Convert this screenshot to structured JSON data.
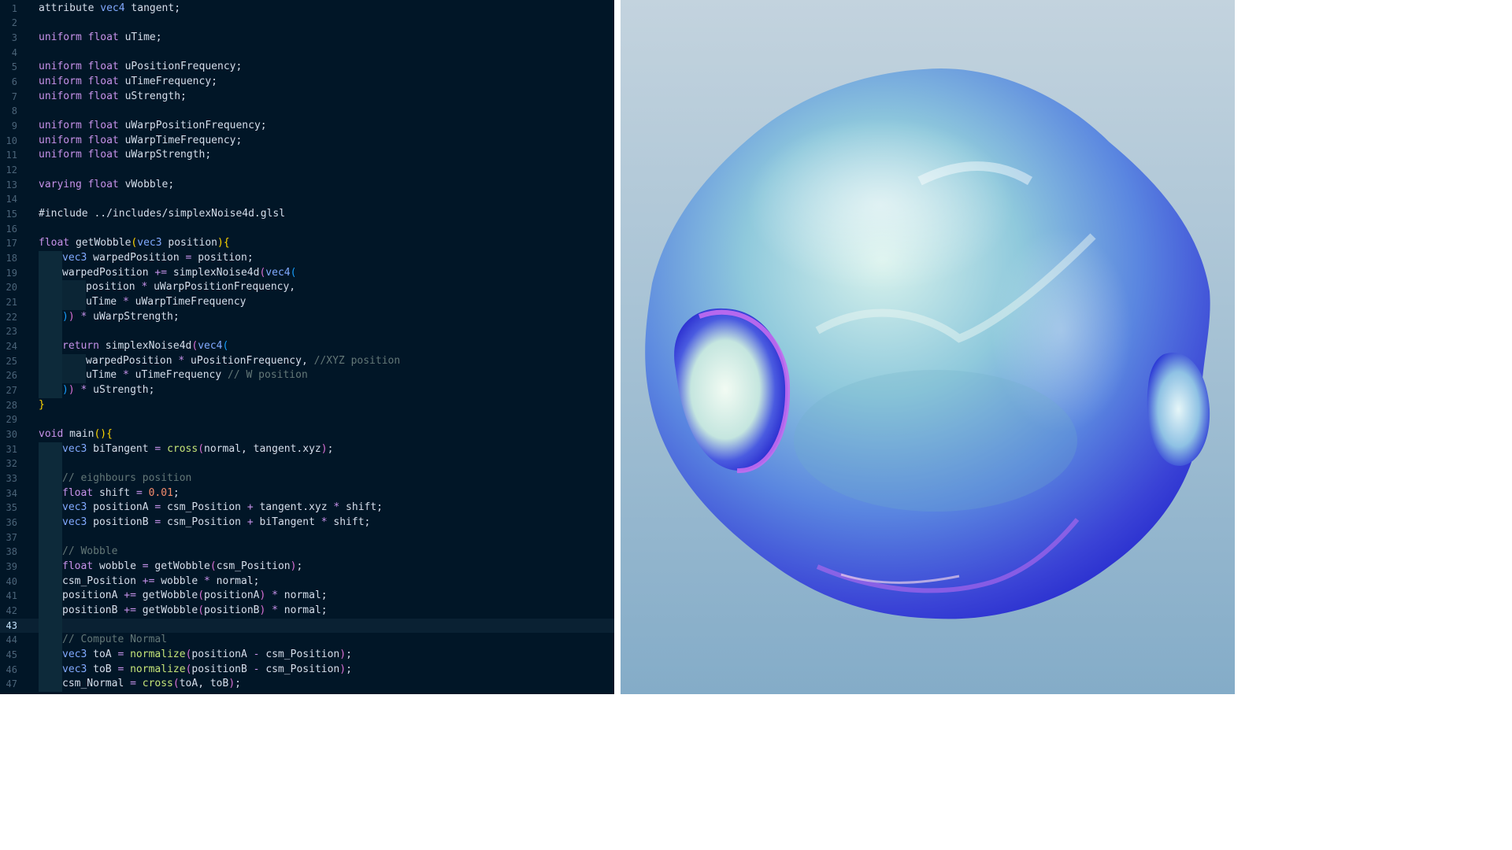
{
  "editor": {
    "current_line": 43,
    "lines": [
      {
        "n": "1",
        "tokens": [
          [
            "id",
            "attribute "
          ],
          [
            "ty",
            "vec4"
          ],
          [
            "id",
            " tangent;"
          ]
        ]
      },
      {
        "n": "2",
        "tokens": []
      },
      {
        "n": "3",
        "tokens": [
          [
            "kw",
            "uniform"
          ],
          [
            "id",
            " "
          ],
          [
            "kw",
            "float"
          ],
          [
            "id",
            " uTime;"
          ]
        ]
      },
      {
        "n": "4",
        "tokens": []
      },
      {
        "n": "5",
        "tokens": [
          [
            "kw",
            "uniform"
          ],
          [
            "id",
            " "
          ],
          [
            "kw",
            "float"
          ],
          [
            "id",
            " uPositionFrequency;"
          ]
        ]
      },
      {
        "n": "6",
        "tokens": [
          [
            "kw",
            "uniform"
          ],
          [
            "id",
            " "
          ],
          [
            "kw",
            "float"
          ],
          [
            "id",
            " uTimeFrequency;"
          ]
        ]
      },
      {
        "n": "7",
        "tokens": [
          [
            "kw",
            "uniform"
          ],
          [
            "id",
            " "
          ],
          [
            "kw",
            "float"
          ],
          [
            "id",
            " uStrength;"
          ]
        ]
      },
      {
        "n": "8",
        "tokens": []
      },
      {
        "n": "9",
        "tokens": [
          [
            "kw",
            "uniform"
          ],
          [
            "id",
            " "
          ],
          [
            "kw",
            "float"
          ],
          [
            "id",
            " uWarpPositionFrequency;"
          ]
        ]
      },
      {
        "n": "10",
        "tokens": [
          [
            "kw",
            "uniform"
          ],
          [
            "id",
            " "
          ],
          [
            "kw",
            "float"
          ],
          [
            "id",
            " uWarpTimeFrequency;"
          ]
        ]
      },
      {
        "n": "11",
        "tokens": [
          [
            "kw",
            "uniform"
          ],
          [
            "id",
            " "
          ],
          [
            "kw",
            "float"
          ],
          [
            "id",
            " uWarpStrength;"
          ]
        ]
      },
      {
        "n": "12",
        "tokens": []
      },
      {
        "n": "13",
        "tokens": [
          [
            "kw",
            "varying"
          ],
          [
            "id",
            " "
          ],
          [
            "kw",
            "float"
          ],
          [
            "id",
            " vWobble;"
          ]
        ]
      },
      {
        "n": "14",
        "tokens": []
      },
      {
        "n": "15",
        "tokens": [
          [
            "id",
            "#include ../includes/simplexNoise4d.glsl"
          ]
        ]
      },
      {
        "n": "16",
        "tokens": []
      },
      {
        "n": "17",
        "tokens": [
          [
            "kw",
            "float"
          ],
          [
            "id",
            " getWobble"
          ],
          [
            "br1",
            "("
          ],
          [
            "ty",
            "vec3"
          ],
          [
            "id",
            " position"
          ],
          [
            "br1",
            ")"
          ],
          [
            "br1",
            "{"
          ]
        ]
      },
      {
        "n": "18",
        "indent": 1,
        "tokens": [
          [
            "ty",
            "vec3"
          ],
          [
            "id",
            " warpedPosition "
          ],
          [
            "op",
            "="
          ],
          [
            "id",
            " position;"
          ]
        ]
      },
      {
        "n": "19",
        "indent": 1,
        "tokens": [
          [
            "id",
            "warpedPosition "
          ],
          [
            "op",
            "+="
          ],
          [
            "id",
            " simplexNoise4d"
          ],
          [
            "br2",
            "("
          ],
          [
            "ty",
            "vec4"
          ],
          [
            "br3",
            "("
          ]
        ]
      },
      {
        "n": "20",
        "indent": 2,
        "tokens": [
          [
            "id",
            "position "
          ],
          [
            "op",
            "*"
          ],
          [
            "id",
            " uWarpPositionFrequency,"
          ]
        ]
      },
      {
        "n": "21",
        "indent": 2,
        "tokens": [
          [
            "id",
            "uTime "
          ],
          [
            "op",
            "*"
          ],
          [
            "id",
            " uWarpTimeFrequency"
          ]
        ]
      },
      {
        "n": "22",
        "indent": 1,
        "tokens": [
          [
            "br3",
            ")"
          ],
          [
            "br2",
            ")"
          ],
          [
            "id",
            " "
          ],
          [
            "op",
            "*"
          ],
          [
            "id",
            " uWarpStrength;"
          ]
        ]
      },
      {
        "n": "23",
        "indent": 1,
        "tokens": []
      },
      {
        "n": "24",
        "indent": 1,
        "tokens": [
          [
            "kw",
            "return"
          ],
          [
            "id",
            " simplexNoise4d"
          ],
          [
            "br2",
            "("
          ],
          [
            "ty",
            "vec4"
          ],
          [
            "br3",
            "("
          ]
        ]
      },
      {
        "n": "25",
        "indent": 2,
        "tokens": [
          [
            "id",
            "warpedPosition "
          ],
          [
            "op",
            "*"
          ],
          [
            "id",
            " uPositionFrequency, "
          ],
          [
            "cm",
            "//XYZ position"
          ]
        ]
      },
      {
        "n": "26",
        "indent": 2,
        "tokens": [
          [
            "id",
            "uTime "
          ],
          [
            "op",
            "*"
          ],
          [
            "id",
            " uTimeFrequency "
          ],
          [
            "cm",
            "// W position"
          ]
        ]
      },
      {
        "n": "27",
        "indent": 1,
        "tokens": [
          [
            "br3",
            ")"
          ],
          [
            "br2",
            ")"
          ],
          [
            "id",
            " "
          ],
          [
            "op",
            "*"
          ],
          [
            "id",
            " uStrength;"
          ]
        ]
      },
      {
        "n": "28",
        "tokens": [
          [
            "br1",
            "}"
          ]
        ]
      },
      {
        "n": "29",
        "tokens": []
      },
      {
        "n": "30",
        "tokens": [
          [
            "kw",
            "void"
          ],
          [
            "id",
            " main"
          ],
          [
            "br1",
            "("
          ],
          [
            "br1",
            ")"
          ],
          [
            "br1",
            "{"
          ]
        ]
      },
      {
        "n": "31",
        "indent": 1,
        "tokens": [
          [
            "ty",
            "vec3"
          ],
          [
            "id",
            " biTangent "
          ],
          [
            "op",
            "="
          ],
          [
            "id",
            " "
          ],
          [
            "bi",
            "cross"
          ],
          [
            "br2",
            "("
          ],
          [
            "id",
            "normal, tangent.xyz"
          ],
          [
            "br2",
            ")"
          ],
          [
            "id",
            ";"
          ]
        ]
      },
      {
        "n": "32",
        "indent": 1,
        "tokens": []
      },
      {
        "n": "33",
        "indent": 1,
        "tokens": [
          [
            "cm",
            "// eighbours position"
          ]
        ]
      },
      {
        "n": "34",
        "indent": 1,
        "tokens": [
          [
            "kw",
            "float"
          ],
          [
            "id",
            " shift "
          ],
          [
            "op",
            "="
          ],
          [
            "id",
            " "
          ],
          [
            "num",
            "0.01"
          ],
          [
            "id",
            ";"
          ]
        ]
      },
      {
        "n": "35",
        "indent": 1,
        "tokens": [
          [
            "ty",
            "vec3"
          ],
          [
            "id",
            " positionA "
          ],
          [
            "op",
            "="
          ],
          [
            "id",
            " csm_Position "
          ],
          [
            "op",
            "+"
          ],
          [
            "id",
            " tangent.xyz "
          ],
          [
            "op",
            "*"
          ],
          [
            "id",
            " shift;"
          ]
        ]
      },
      {
        "n": "36",
        "indent": 1,
        "tokens": [
          [
            "ty",
            "vec3"
          ],
          [
            "id",
            " positionB "
          ],
          [
            "op",
            "="
          ],
          [
            "id",
            " csm_Position "
          ],
          [
            "op",
            "+"
          ],
          [
            "id",
            " biTangent "
          ],
          [
            "op",
            "*"
          ],
          [
            "id",
            " shift;"
          ]
        ]
      },
      {
        "n": "37",
        "indent": 1,
        "tokens": []
      },
      {
        "n": "38",
        "indent": 1,
        "tokens": [
          [
            "cm",
            "// Wobble"
          ]
        ]
      },
      {
        "n": "39",
        "indent": 1,
        "tokens": [
          [
            "kw",
            "float"
          ],
          [
            "id",
            " wobble "
          ],
          [
            "op",
            "="
          ],
          [
            "id",
            " getWobble"
          ],
          [
            "br2",
            "("
          ],
          [
            "id",
            "csm_Position"
          ],
          [
            "br2",
            ")"
          ],
          [
            "id",
            ";"
          ]
        ]
      },
      {
        "n": "40",
        "indent": 1,
        "tokens": [
          [
            "id",
            "csm_Position "
          ],
          [
            "op",
            "+="
          ],
          [
            "id",
            " wobble "
          ],
          [
            "op",
            "*"
          ],
          [
            "id",
            " normal;"
          ]
        ]
      },
      {
        "n": "41",
        "indent": 1,
        "tokens": [
          [
            "id",
            "positionA "
          ],
          [
            "op",
            "+="
          ],
          [
            "id",
            " getWobble"
          ],
          [
            "br2",
            "("
          ],
          [
            "id",
            "positionA"
          ],
          [
            "br2",
            ")"
          ],
          [
            "id",
            " "
          ],
          [
            "op",
            "*"
          ],
          [
            "id",
            " normal;"
          ]
        ]
      },
      {
        "n": "42",
        "indent": 1,
        "tokens": [
          [
            "id",
            "positionB "
          ],
          [
            "op",
            "+="
          ],
          [
            "id",
            " getWobble"
          ],
          [
            "br2",
            "("
          ],
          [
            "id",
            "positionB"
          ],
          [
            "br2",
            ")"
          ],
          [
            "id",
            " "
          ],
          [
            "op",
            "*"
          ],
          [
            "id",
            " normal;"
          ]
        ]
      },
      {
        "n": "43",
        "indent": 1,
        "tokens": []
      },
      {
        "n": "44",
        "indent": 1,
        "tokens": [
          [
            "cm",
            "// Compute Normal"
          ]
        ]
      },
      {
        "n": "45",
        "indent": 1,
        "tokens": [
          [
            "ty",
            "vec3"
          ],
          [
            "id",
            " toA "
          ],
          [
            "op",
            "="
          ],
          [
            "id",
            " "
          ],
          [
            "bi",
            "normalize"
          ],
          [
            "br2",
            "("
          ],
          [
            "id",
            "positionA "
          ],
          [
            "op",
            "-"
          ],
          [
            "id",
            " csm_Position"
          ],
          [
            "br2",
            ")"
          ],
          [
            "id",
            ";"
          ]
        ]
      },
      {
        "n": "46",
        "indent": 1,
        "tokens": [
          [
            "ty",
            "vec3"
          ],
          [
            "id",
            " toB "
          ],
          [
            "op",
            "="
          ],
          [
            "id",
            " "
          ],
          [
            "bi",
            "normalize"
          ],
          [
            "br2",
            "("
          ],
          [
            "id",
            "positionB "
          ],
          [
            "op",
            "-"
          ],
          [
            "id",
            " csm_Position"
          ],
          [
            "br2",
            ")"
          ],
          [
            "id",
            ";"
          ]
        ]
      },
      {
        "n": "47",
        "indent": 1,
        "tokens": [
          [
            "id",
            "csm_Normal "
          ],
          [
            "op",
            "="
          ],
          [
            "id",
            " "
          ],
          [
            "bi",
            "cross"
          ],
          [
            "br2",
            "("
          ],
          [
            "id",
            "toA, toB"
          ],
          [
            "br2",
            ")"
          ],
          [
            "id",
            ";"
          ]
        ]
      }
    ]
  },
  "viewport": {
    "subject": "wobbly-sphere",
    "colors": {
      "background_top": "#c3d3de",
      "background_bottom": "#84acc8",
      "sphere_core": "#5a86e0",
      "sphere_highlight": "#bfe6e6",
      "sphere_shadow": "#2a2fcf",
      "rim_accent": "#c36cf0"
    }
  }
}
